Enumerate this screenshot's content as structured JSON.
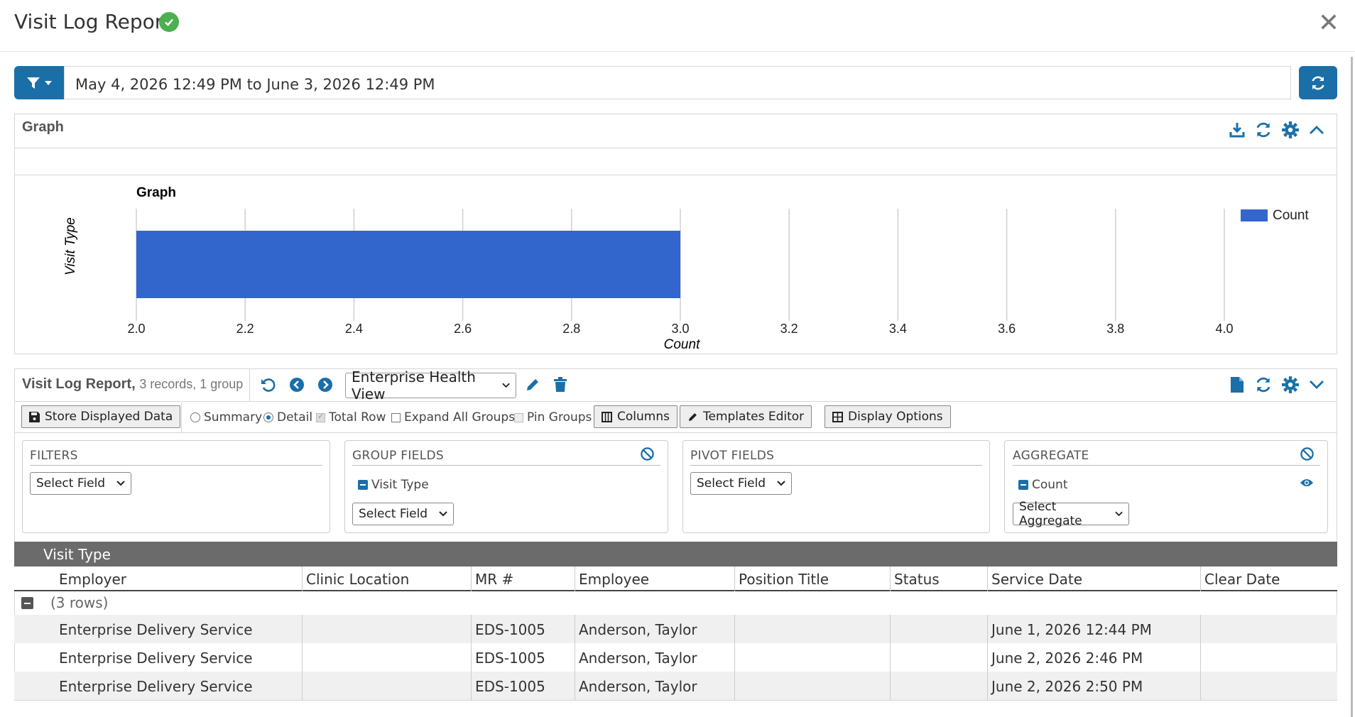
{
  "window": {
    "title": "Visit Log Report",
    "close_label": "✕"
  },
  "filter_bar": {
    "date_range": "May 4, 2026 12:49 PM to June 3, 2026 12:49 PM"
  },
  "graph_panel": {
    "header": "Graph",
    "icons": [
      "download-icon",
      "refresh-icon",
      "gear-icon",
      "chevron-up-icon"
    ]
  },
  "chart_data": {
    "type": "bar",
    "orientation": "horizontal",
    "title": "Graph",
    "xlabel": "Count",
    "ylabel": "Visit Type",
    "categories": [
      ""
    ],
    "series": [
      {
        "name": "Count",
        "values": [
          3
        ],
        "color": "#3366cc"
      }
    ],
    "xlim": [
      2.0,
      4.0
    ],
    "xticks": [
      "2.0",
      "2.2",
      "2.4",
      "2.6",
      "2.8",
      "3.0",
      "3.2",
      "3.4",
      "3.6",
      "3.8",
      "4.0"
    ],
    "legend": "top-right",
    "grid": true
  },
  "report": {
    "title": "Visit Log Report,",
    "subtitle": "3 records, 1 group",
    "view": "Enterprise Health View",
    "toolbar": {
      "store": "Store Displayed Data",
      "summary": "Summary",
      "detail": "Detail",
      "total_row": "Total Row",
      "expand_groups": "Expand All Groups",
      "pin_groups": "Pin Groups",
      "columns": "Columns",
      "templates": "Templates Editor",
      "display_options": "Display Options"
    },
    "boxes": {
      "filters": {
        "title": "FILTERS",
        "select": "Select Field"
      },
      "group_fields": {
        "title": "GROUP FIELDS",
        "item": "Visit Type",
        "select": "Select Field"
      },
      "pivot_fields": {
        "title": "PIVOT FIELDS",
        "select": "Select Field"
      },
      "aggregate": {
        "title": "AGGREGATE",
        "item": "Count",
        "select": "Select Aggregate"
      }
    },
    "group_header": "Visit Type",
    "columns": [
      "Employer",
      "Clinic Location",
      "MR #",
      "Employee",
      "Position Title",
      "Status",
      "Service Date",
      "Clear Date"
    ],
    "group_label": "(3 rows)",
    "rows": [
      [
        "Enterprise Delivery Service",
        "",
        "EDS-1005",
        "Anderson, Taylor",
        "",
        "",
        "June 1, 2026 12:44 PM",
        ""
      ],
      [
        "Enterprise Delivery Service",
        "",
        "EDS-1005",
        "Anderson, Taylor",
        "",
        "",
        "June 2, 2026 2:46 PM",
        ""
      ],
      [
        "Enterprise Delivery Service",
        "",
        "EDS-1005",
        "Anderson, Taylor",
        "",
        "",
        "June 2, 2026 2:50 PM",
        ""
      ]
    ]
  },
  "colors": {
    "accent": "#1a6fa8",
    "bar": "#3366cc",
    "success": "#4caf50",
    "group_bar": "#6b6b6b"
  }
}
